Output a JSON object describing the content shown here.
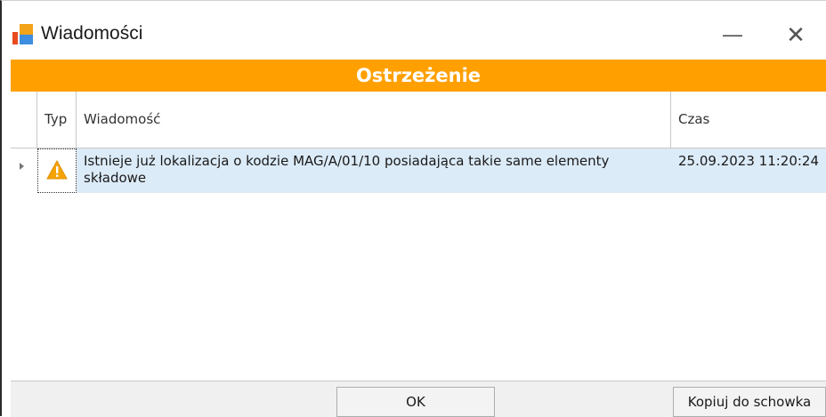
{
  "window": {
    "title": "Wiadomości",
    "minimize_glyph": "—",
    "close_glyph": "✕"
  },
  "banner": {
    "text": "Ostrzeżenie",
    "color": "#ffa000"
  },
  "grid": {
    "columns": [
      "Typ",
      "Wiadomość",
      "Czas"
    ],
    "rows": [
      {
        "type_icon": "warning-icon",
        "message": "Istnieje już lokalizacja o kodzie MAG/A/01/10 posiadająca takie same elementy składowe",
        "time": "25.09.2023 11:20:24",
        "selected": true
      }
    ]
  },
  "footer": {
    "ok_label": "OK",
    "copy_label": "Kopiuj do schowka"
  }
}
